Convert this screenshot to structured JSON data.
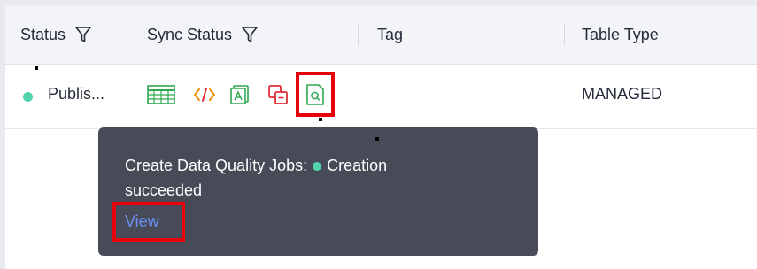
{
  "table": {
    "headers": {
      "status": "Status",
      "sync_status": "Sync Status",
      "tag": "Tag",
      "table_type": "Table Type"
    },
    "row": {
      "status": "Publis...",
      "tag": "",
      "table_type": "MANAGED"
    },
    "sync_icons": [
      "table-grid-icon",
      "code-icon",
      "data-map-icon",
      "copy-link-icon",
      "quality-search-icon"
    ]
  },
  "tooltip": {
    "label": "Create Data Quality Jobs:",
    "status": "Creation",
    "status_cont": "succeeded",
    "link": "View"
  },
  "colors": {
    "header_bg": "#f3f4f7",
    "status_green": "#50d4ab",
    "tooltip_bg": "#464b57",
    "link": "#6b8ff0",
    "highlight": "#e8000b"
  }
}
